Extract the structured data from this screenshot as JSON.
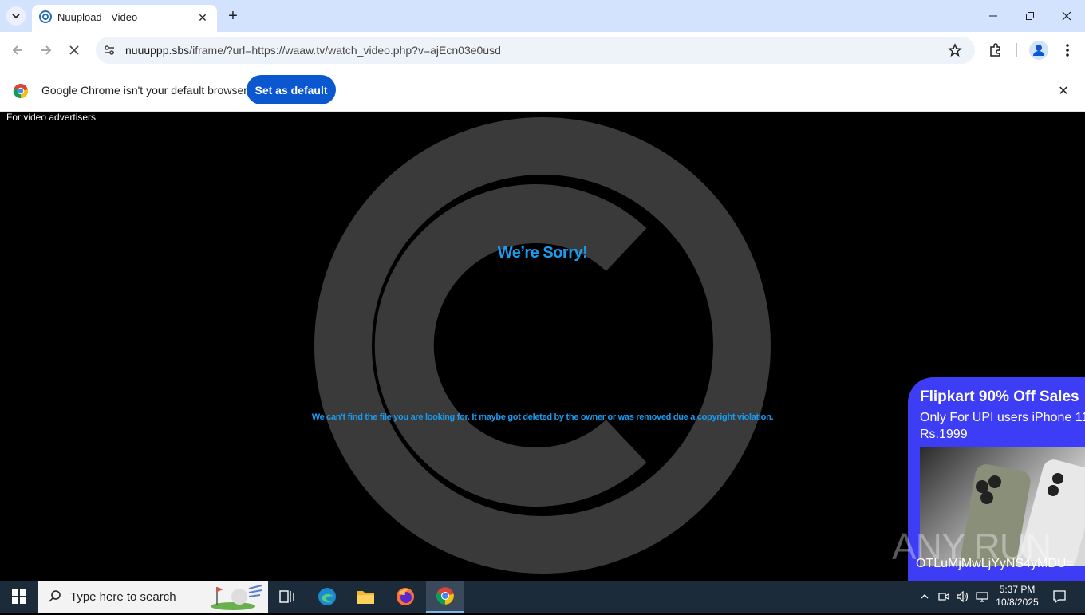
{
  "browser": {
    "tab": {
      "title": "Nuupload - Video",
      "favicon": "nuupload-favicon-icon"
    },
    "url_host": "nuuuppp.sbs",
    "url_rest": "/iframe/?url=https://waaw.tv/watch_video.php?v=ajEcn03e0usd",
    "infobar": {
      "text": "Google Chrome isn't your default browser",
      "button": "Set as default"
    }
  },
  "page": {
    "ad_label": "For video advertisers",
    "heading": "We’re Sorry!",
    "message": "We can't find the file you are looking for. It maybe got deleted by the owner or was removed due a copyright violation.",
    "accent_color": "#1a9bf0"
  },
  "ad": {
    "title": "Flipkart 90% Off Sales",
    "subtitle": "Only For UPI users iPhone 11 Rs.1999",
    "code": "OTLuMjMwLjYyNS4yMDU="
  },
  "watermark": "ANY RUN",
  "taskbar": {
    "search_placeholder": "Type here to search",
    "time": "5:37 PM",
    "date": "10/8/2025"
  }
}
